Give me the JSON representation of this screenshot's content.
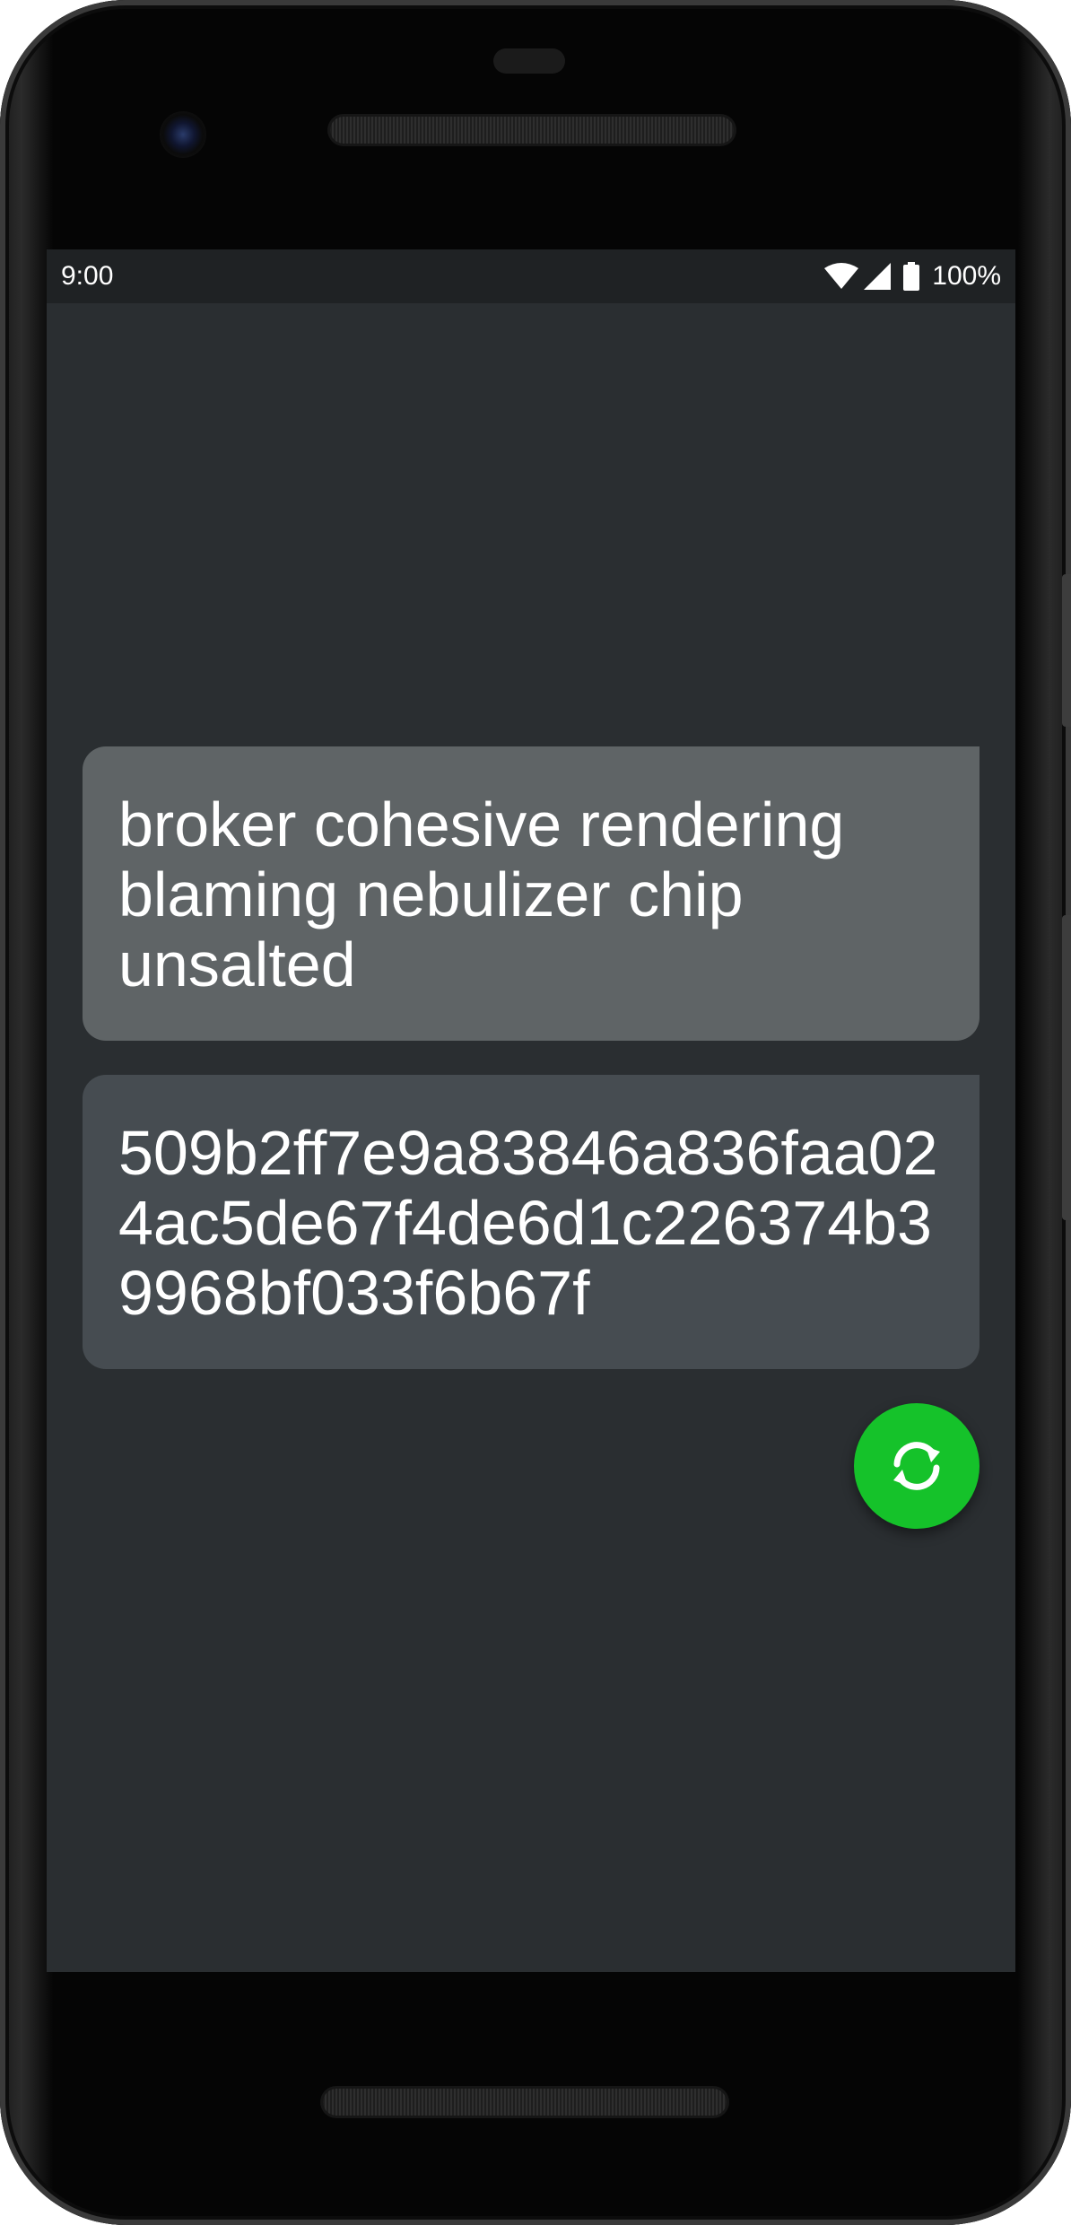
{
  "status_bar": {
    "time": "9:00",
    "battery_percent": "100%",
    "icons": [
      "wifi-icon",
      "cell-signal-icon",
      "battery-icon"
    ]
  },
  "main": {
    "words_card": {
      "text": "broker cohesive rendering blaming nebulizer chip unsalted"
    },
    "hash_card": {
      "text": "509b2ff7e9a83846a836faa024ac5de67f4de6d1c226374b39968bf033f6b67f"
    },
    "refresh_button": {
      "icon": "refresh-icon",
      "color": "#15c22a"
    }
  },
  "colors": {
    "screen_background": "#2a2e31",
    "status_bar_background": "#1f2224",
    "words_card_background": "#5f6466",
    "hash_card_background": "#464c51"
  }
}
